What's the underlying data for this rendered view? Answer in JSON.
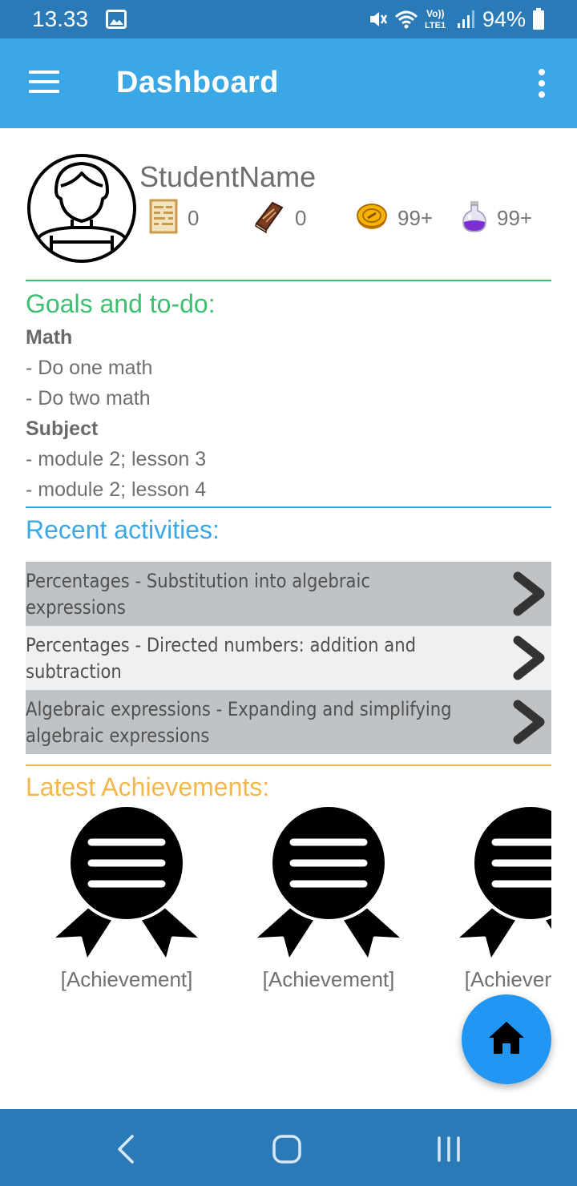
{
  "status_bar": {
    "time": "13.33",
    "battery": "94%",
    "icons": [
      "image-icon",
      "mute-icon",
      "wifi-icon",
      "volte-icon",
      "signal-icon",
      "battery-icon"
    ]
  },
  "app_bar": {
    "title": "Dashboard",
    "menu_icon": "menu-icon",
    "overflow_icon": "more-vert-icon"
  },
  "profile": {
    "name": "StudentName",
    "stats": [
      {
        "icon": "abacus-icon",
        "value": "0"
      },
      {
        "icon": "book-icon",
        "value": "0"
      },
      {
        "icon": "coin-icon",
        "value": "99+"
      },
      {
        "icon": "potion-icon",
        "value": "99+"
      }
    ]
  },
  "goals": {
    "title": "Goals and to-do:",
    "color": "#3cbf6e",
    "items": [
      {
        "text": "Math",
        "bold": true
      },
      {
        "text": "- Do one math",
        "bold": false
      },
      {
        "text": "- Do two math",
        "bold": false
      },
      {
        "text": "Subject",
        "bold": true
      },
      {
        "text": "- module 2; lesson 3",
        "bold": false
      },
      {
        "text": "- module 2; lesson 4",
        "bold": false
      }
    ]
  },
  "recent": {
    "title": "Recent activities:",
    "color": "#3aa8e6",
    "items": [
      {
        "line1": "Percentages - Substitution into algebraic",
        "line2": "expressions",
        "bg": "#bfc3c6"
      },
      {
        "line1": "Percentages - Directed numbers: addition and",
        "line2": "subtraction",
        "bg": "#eef0f1"
      },
      {
        "line1": "Algebraic expressions - Expanding and simplifying",
        "line2": "algebraic expressions",
        "bg": "#bfc3c6"
      }
    ]
  },
  "achievements": {
    "title": "Latest Achievements:",
    "color": "#f3b84c",
    "items": [
      {
        "label": "[Achievement]",
        "icon": "award-ribbon-icon"
      },
      {
        "label": "[Achievement]",
        "icon": "award-ribbon-icon"
      },
      {
        "label": "[Achievement]",
        "icon": "award-ribbon-icon"
      }
    ]
  },
  "fab": {
    "icon": "home-icon",
    "color": "#2196f3"
  },
  "nav_bar": {
    "icons": [
      "back-icon",
      "home-circle-icon",
      "recents-icon"
    ]
  }
}
